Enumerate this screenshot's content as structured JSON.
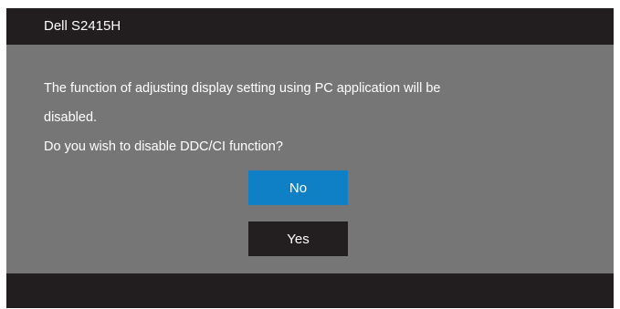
{
  "dialog": {
    "title": "Dell S2415H",
    "message_lines": [
      "The function of adjusting display setting using PC application will be",
      "disabled.",
      "Do you wish to disable DDC/CI function?"
    ],
    "buttons": {
      "no_label": "No",
      "yes_label": "Yes"
    },
    "selected_button": "No"
  },
  "colors": {
    "title_bar": "#221e1f",
    "body": "#767676",
    "selected_button": "#0f80c5",
    "unselected_button": "#231f20",
    "text": "#ffffff"
  }
}
